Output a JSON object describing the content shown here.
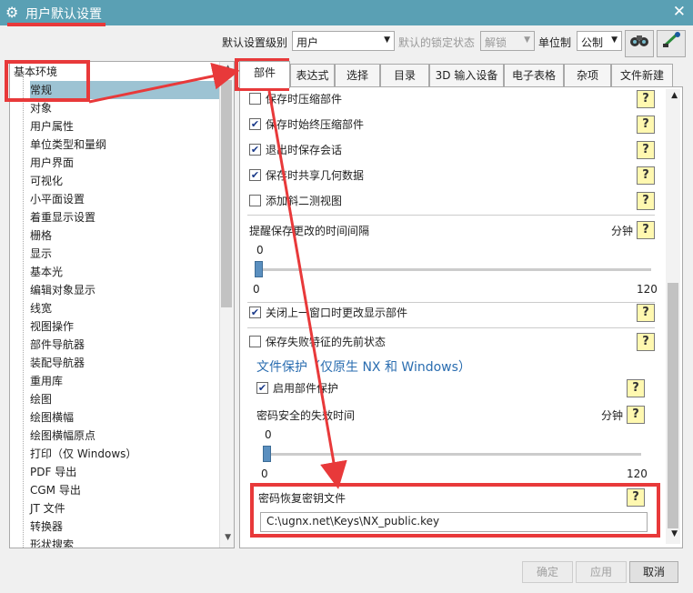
{
  "window": {
    "title": "用户默认设置",
    "close_glyph": "✕"
  },
  "toolbar": {
    "level_label": "默认设置级别",
    "level_value": "用户",
    "lock_label": "默认的锁定状态",
    "lock_value": "解锁",
    "unit_label": "单位制",
    "unit_value": "公制"
  },
  "tree": {
    "root": "基本环境",
    "items": [
      "常规",
      "对象",
      "用户属性",
      "单位类型和量纲",
      "用户界面",
      "可视化",
      "小平面设置",
      "着重显示设置",
      "栅格",
      "显示",
      "基本光",
      "编辑对象显示",
      "线宽",
      "视图操作",
      "部件导航器",
      "装配导航器",
      "重用库",
      "绘图",
      "绘图横幅",
      "绘图横幅原点",
      "打印（仅 Windows）",
      "PDF 导出",
      "CGM 导出",
      "JT 文件",
      "转换器",
      "形状搜索"
    ]
  },
  "tabs": [
    "部件",
    "表达式",
    "选择",
    "目录",
    "3D 输入设备",
    "电子表格",
    "杂项",
    "文件新建"
  ],
  "panel": {
    "cb1": "保存时压缩部件",
    "cb2": "保存时始终压缩部件",
    "cb3": "退出时保存会话",
    "cb4": "保存时共享几何数据",
    "cb5": "添加斜二测视图",
    "reminder_label": "提醒保存更改的时间间隔",
    "unit_minutes": "分钟",
    "slider1_value": "0",
    "slider1_min": "0",
    "slider1_max": "120",
    "cb6": "关闭上一窗口时更改显示部件",
    "cb7": "保存失败特征的先前状态",
    "file_protection_title": "文件保护（仅原生 NX 和 Windows）",
    "cb8": "启用部件保护",
    "pw_timeout_label": "密码安全的失效时间",
    "unit_minutes2": "分钟",
    "slider2_value": "0",
    "slider2_min": "0",
    "slider2_max": "120",
    "key_file_label": "密码恢复密钥文件",
    "key_file_value": "C:\\ugnx.net\\Keys\\NX_public.key",
    "help_glyph": "?"
  },
  "buttons": {
    "ok": "确定",
    "apply": "应用",
    "cancel": "取消"
  },
  "colors": {
    "titlebar": "#5aa0b4",
    "highlight": "#e8393a",
    "selected": "#9dc3d3"
  }
}
